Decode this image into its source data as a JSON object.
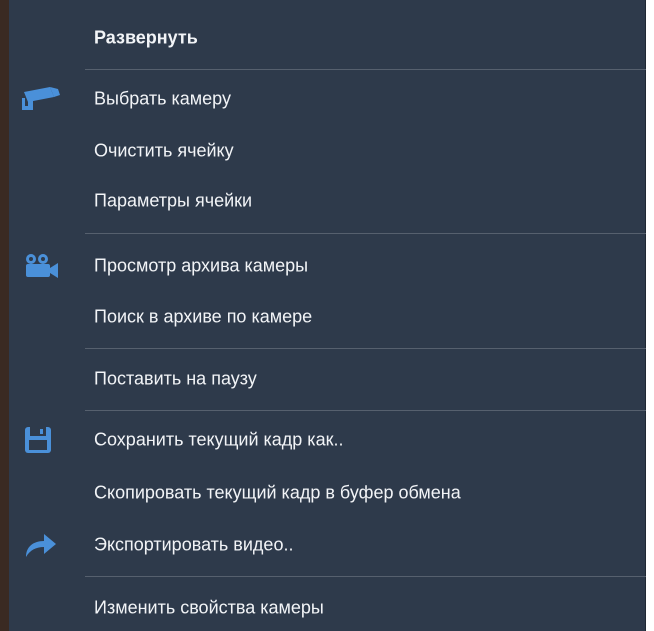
{
  "menu": {
    "items": [
      {
        "id": "expand",
        "label": "Развернуть",
        "bold": true,
        "icon": ""
      },
      {
        "id": "select-camera",
        "label": "Выбрать камеру",
        "bold": false,
        "icon": "security-camera-icon"
      },
      {
        "id": "clear-cell",
        "label": "Очистить ячейку",
        "bold": false,
        "icon": ""
      },
      {
        "id": "cell-params",
        "label": "Параметры ячейки",
        "bold": false,
        "icon": ""
      },
      {
        "id": "view-archive",
        "label": "Просмотр архива камеры",
        "bold": false,
        "icon": "video-camera-icon"
      },
      {
        "id": "search-archive",
        "label": "Поиск в архиве по камере",
        "bold": false,
        "icon": ""
      },
      {
        "id": "pause",
        "label": "Поставить на паузу",
        "bold": false,
        "icon": ""
      },
      {
        "id": "save-frame",
        "label": "Сохранить текущий кадр как..",
        "bold": false,
        "icon": "save-icon"
      },
      {
        "id": "copy-frame",
        "label": "Скопировать текущий кадр в буфер обмена",
        "bold": false,
        "icon": ""
      },
      {
        "id": "export-video",
        "label": "Экспортировать видео..",
        "bold": false,
        "icon": "share-arrow-icon"
      },
      {
        "id": "camera-props",
        "label": "Изменить свойства камеры",
        "bold": false,
        "icon": ""
      }
    ]
  },
  "colors": {
    "menu_background": "#2e3a4b",
    "text": "#f2f4f7",
    "icon": "#4a90d9",
    "separator": "#56606e"
  }
}
